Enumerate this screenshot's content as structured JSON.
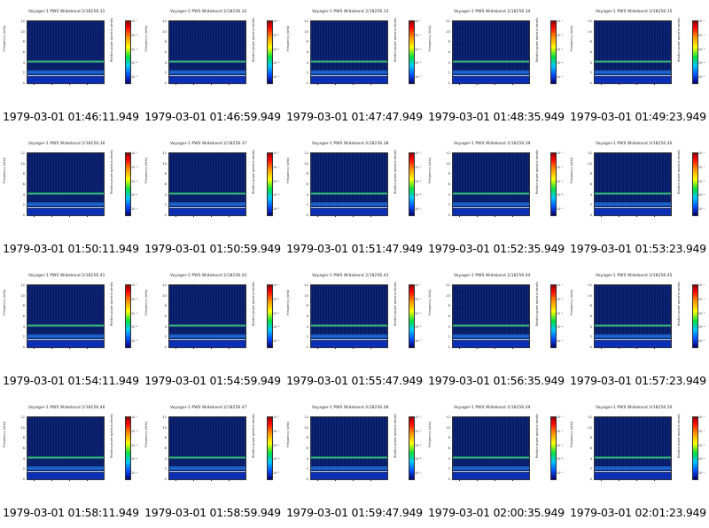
{
  "cells": [
    {
      "title": "Voyager-1 PWS Wideband 2/18256.31",
      "caption": "1979-03-01 01:46:11.949"
    },
    {
      "title": "Voyager-1 PWS Wideband 2/18256.32",
      "caption": "1979-03-01 01:46:59.949"
    },
    {
      "title": "Voyager-1 PWS Wideband 2/18256.33",
      "caption": "1979-03-01 01:47:47.949"
    },
    {
      "title": "Voyager-1 PWS Wideband 2/18256.34",
      "caption": "1979-03-01 01:48:35.949"
    },
    {
      "title": "Voyager-1 PWS Wideband 2/18256.35",
      "caption": "1979-03-01 01:49:23.949"
    },
    {
      "title": "Voyager-1 PWS Wideband 2/18256.36",
      "caption": "1979-03-01 01:50:11.949"
    },
    {
      "title": "Voyager-1 PWS Wideband 2/18256.37",
      "caption": "1979-03-01 01:50:59.949"
    },
    {
      "title": "Voyager-1 PWS Wideband 2/18256.38",
      "caption": "1979-03-01 01:51:47.949"
    },
    {
      "title": "Voyager-1 PWS Wideband 2/18256.39",
      "caption": "1979-03-01 01:52:35.949"
    },
    {
      "title": "Voyager-1 PWS Wideband 2/18256.40",
      "caption": "1979-03-01 01:53:23.949"
    },
    {
      "title": "Voyager-1 PWS Wideband 2/18256.41",
      "caption": "1979-03-01 01:54:11.949"
    },
    {
      "title": "Voyager-1 PWS Wideband 2/18256.42",
      "caption": "1979-03-01 01:54:59.949"
    },
    {
      "title": "Voyager-1 PWS Wideband 2/18256.43",
      "caption": "1979-03-01 01:55:47.949"
    },
    {
      "title": "Voyager-1 PWS Wideband 2/18256.44",
      "caption": "1979-03-01 01:56:35.949"
    },
    {
      "title": "Voyager-1 PWS Wideband 2/18256.45",
      "caption": "1979-03-01 01:57:23.949"
    },
    {
      "title": "Voyager-1 PWS Wideband 2/18256.46",
      "caption": "1979-03-01 01:58:11.949"
    },
    {
      "title": "Voyager-1 PWS Wideband 2/18256.47",
      "caption": "1979-03-01 01:58:59.949"
    },
    {
      "title": "Voyager-1 PWS Wideband 2/18256.48",
      "caption": "1979-03-01 01:59:47.949"
    },
    {
      "title": "Voyager-1 PWS Wideband 2/18256.49",
      "caption": "1979-03-01 02:00:35.949"
    },
    {
      "title": "Voyager-1 PWS Wideband 2/18256.50",
      "caption": "1979-03-01 02:01:23.949"
    }
  ],
  "ylabel": "Frequency (kHz)",
  "yticks": [
    "12",
    "10",
    "8",
    "6",
    "4",
    "2",
    "0"
  ],
  "colorbar_label": "Relative power spectral density",
  "colorbar_ticks": [
    "10⁻¹",
    "10⁻²",
    "10⁻³",
    "10⁻⁴",
    "10⁻⁵"
  ],
  "colors": {
    "background": "#07175e",
    "band_line": "#3ccc7a",
    "low_band": "#1f6fd8",
    "bottom_strip": "#0a2fb5"
  }
}
